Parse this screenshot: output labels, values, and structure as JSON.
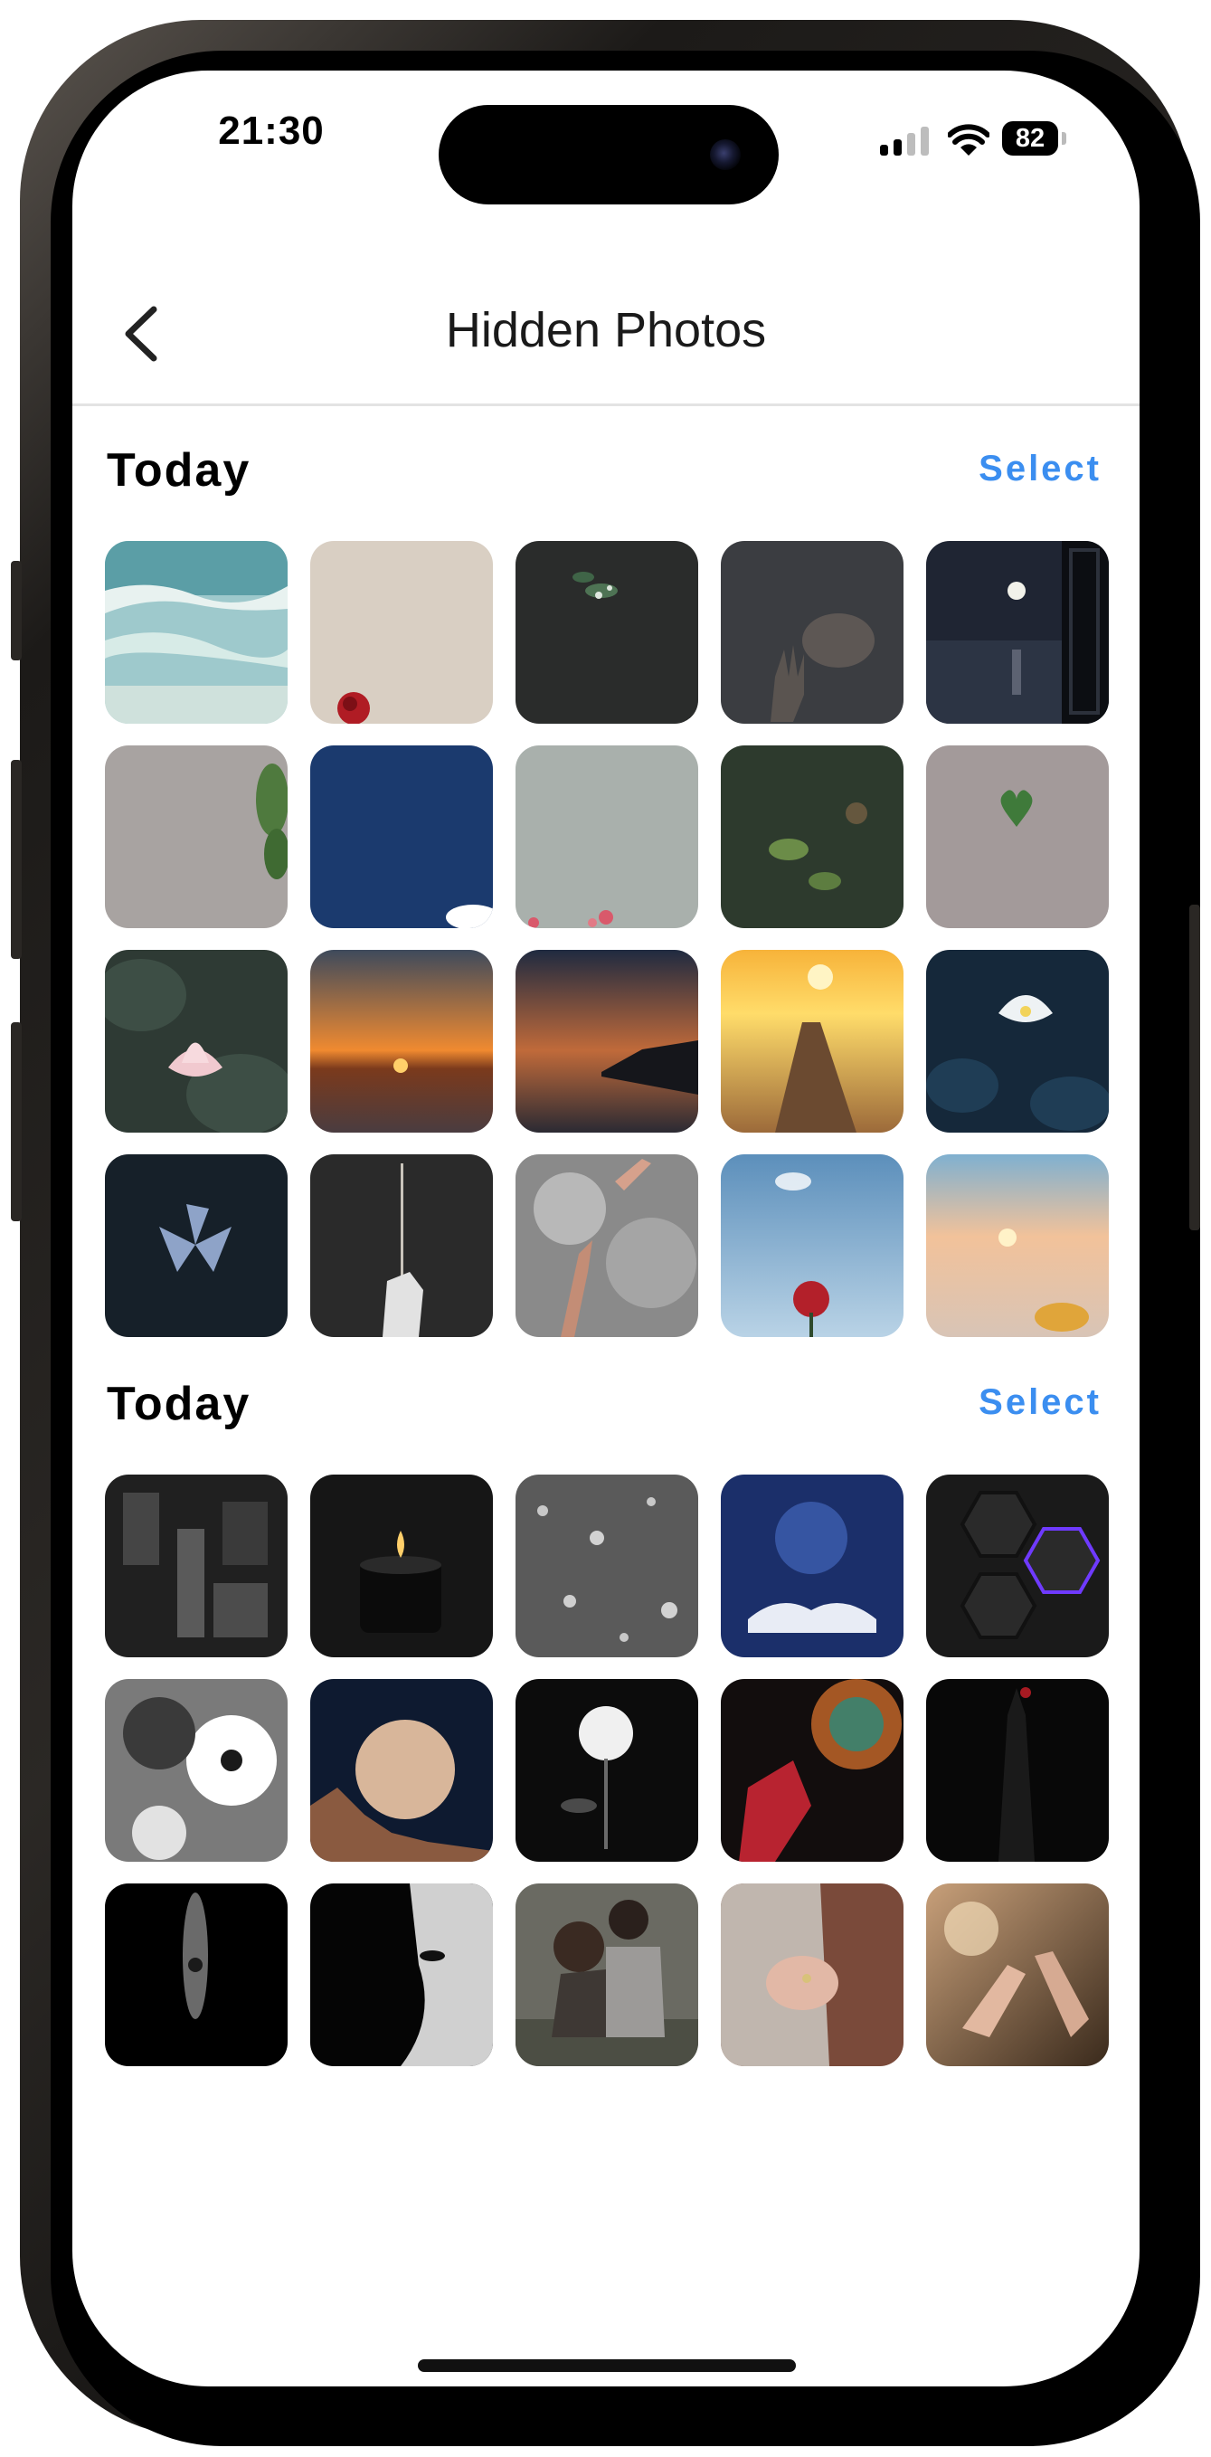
{
  "status_bar": {
    "time": "21:30",
    "battery": "82",
    "icons": [
      "cellular-signal-icon",
      "wifi-icon",
      "battery-icon"
    ]
  },
  "nav": {
    "back_icon": "chevron-left-icon",
    "title": "Hidden Photos"
  },
  "sections": [
    {
      "title": "Today",
      "select_label": "Select",
      "photos": [
        "ocean-waves",
        "rose-on-beige",
        "dark-leaves",
        "hand-in-smoke",
        "moon-over-water",
        "gray-wall-ivy",
        "blue-sky-cloud",
        "gray-pink-flowers",
        "green-leaf-bokeh",
        "heart-leaf",
        "pink-lotus",
        "orange-sunset-sea",
        "dusk-coast",
        "sunset-pier",
        "white-lotus-dark",
        "blue-flower-dark",
        "hand-holding-stem",
        "hands-clouds",
        "rose-blue-sky",
        "beach-sunset-bottle"
      ]
    },
    {
      "title": "Today",
      "select_label": "Select",
      "photos": [
        "city-aerial-bw",
        "candle-jar",
        "rain-drops",
        "glowing-book",
        "purple-hexagons",
        "daisies-bw",
        "full-moon-cliffs",
        "white-rose-dark",
        "mandala-figure",
        "dark-silhouette",
        "eye-in-shadow",
        "face-in-shadow",
        "couple-sitting",
        "holding-hands",
        "hands-touching"
      ]
    }
  ],
  "colors": {
    "accent": "#3b8ef0",
    "background": "#ffffff",
    "title_text": "#1a1a1a"
  }
}
